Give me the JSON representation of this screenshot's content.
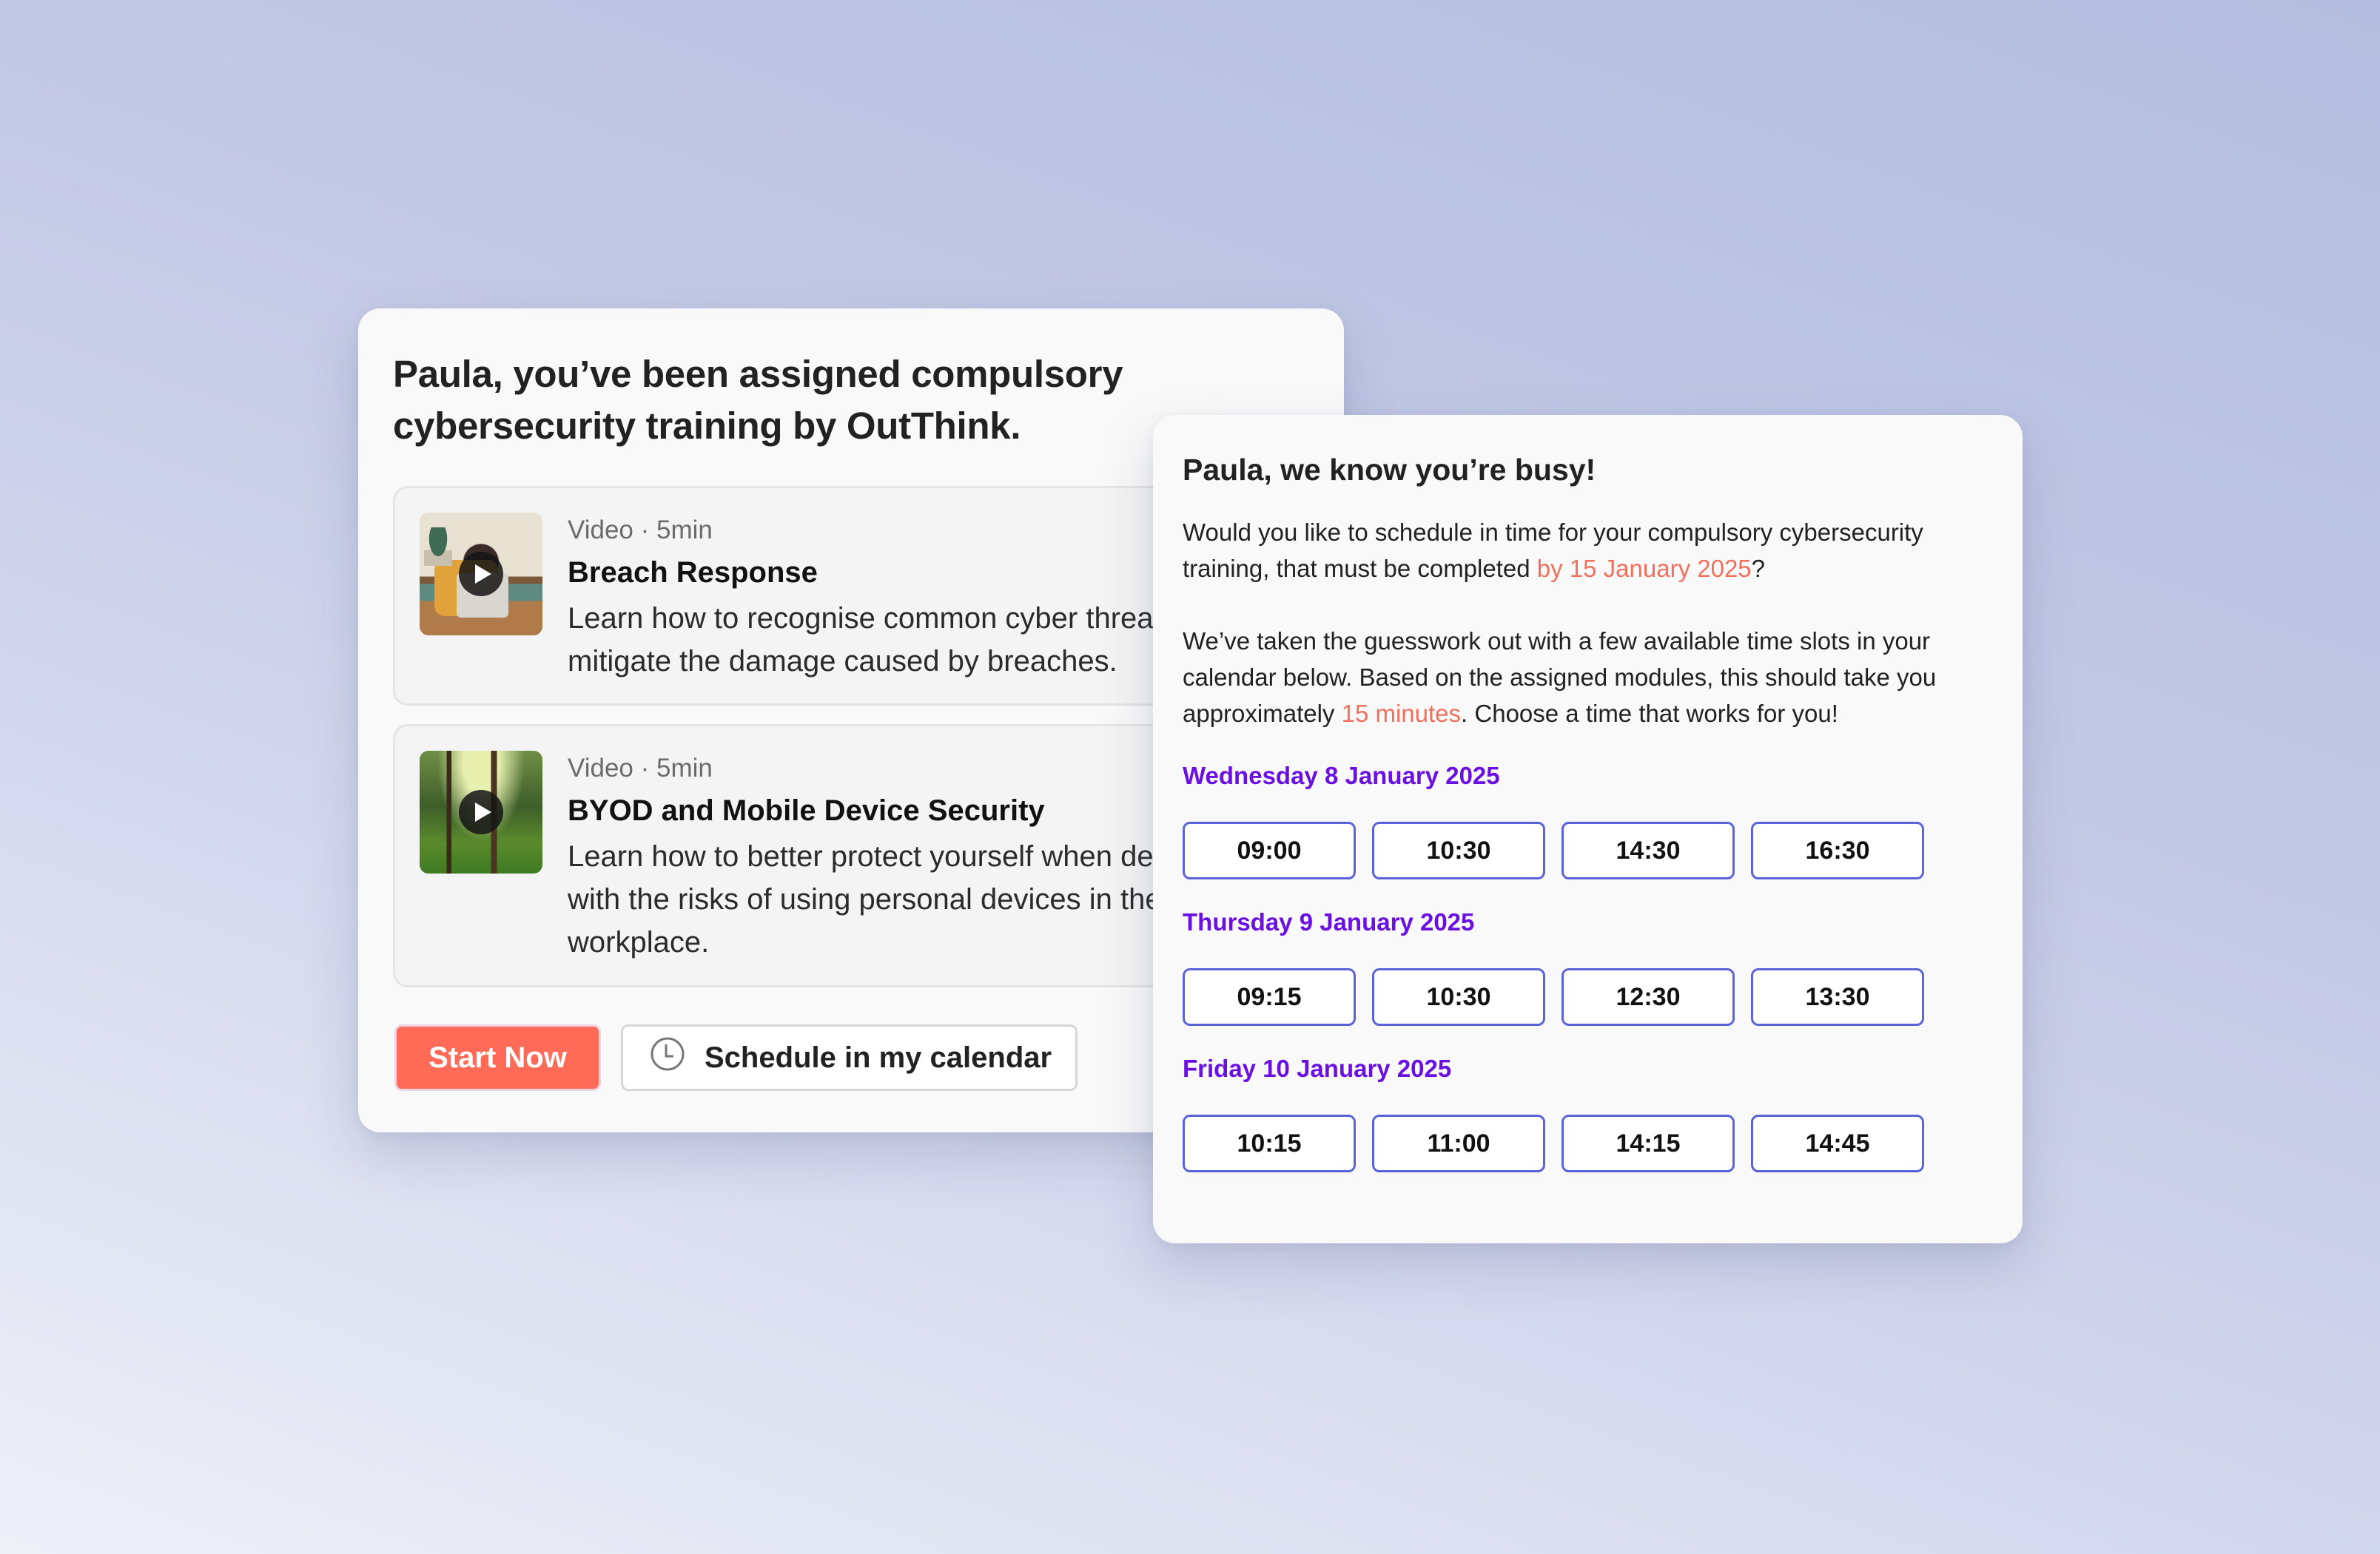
{
  "assignment_card": {
    "title": "Paula, you’ve been assigned compulsory cybersecurity training by OutThink.",
    "modules": [
      {
        "meta": "Video · 5min",
        "title": "Breach Response",
        "description": "Learn how to recognise common cyber threats and\nmitigate the damage caused by breaches.",
        "thumbnail": "illustration-woman-at-laptop"
      },
      {
        "meta": "Video · 5min",
        "title": "BYOD and Mobile Device Security",
        "description": "Learn how to better protect yourself when dealing\nwith the risks of using personal devices in the\nworkplace.",
        "thumbnail": "forest-photo"
      }
    ],
    "start_button": "Start Now",
    "schedule_button": "Schedule in my calendar",
    "schedule_icon": "clock-icon"
  },
  "schedule_card": {
    "title": "Paula, we know you’re busy!",
    "para1_before": "Would you like to schedule in time for your compulsory cybersecurity training, that must be completed ",
    "para1_highlight": "by 15 January 2025",
    "para1_after": "?",
    "para2_before": "We’ve taken the guesswork out with a few available time slots in your calendar below. Based on the assigned modules, this should take you approximately ",
    "para2_highlight": "15 minutes",
    "para2_after": ". Choose a time that works for you!",
    "days": [
      {
        "label": "Wednesday 8 January 2025",
        "slots": [
          "09:00",
          "10:30",
          "14:30",
          "16:30"
        ]
      },
      {
        "label": "Thursday 9 January 2025",
        "slots": [
          "09:15",
          "10:30",
          "12:30",
          "13:30"
        ]
      },
      {
        "label": "Friday 10 January 2025",
        "slots": [
          "10:15",
          "11:00",
          "14:15",
          "14:45"
        ]
      }
    ]
  },
  "colors": {
    "primary_button": "#ff6b57",
    "highlight_text": "#f0705c",
    "day_heading": "#6a10e0",
    "slot_border": "#5a63d8"
  }
}
